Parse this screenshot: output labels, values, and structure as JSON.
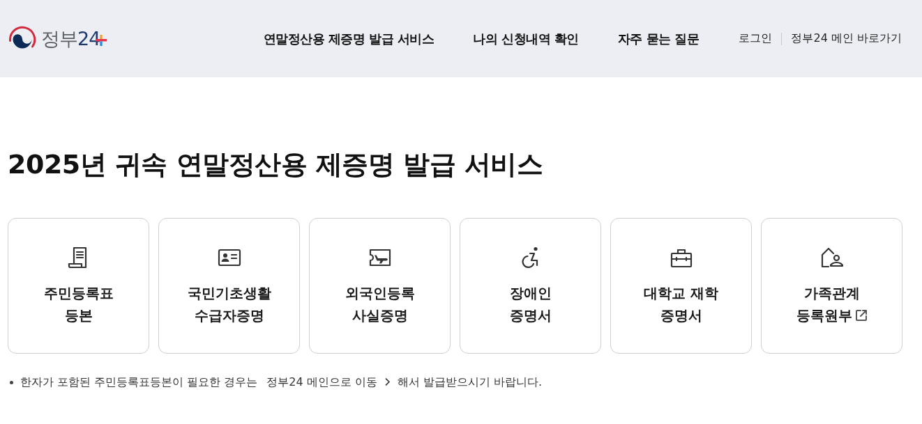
{
  "header": {
    "logo": {
      "name": "정부",
      "number": "24"
    },
    "nav": [
      {
        "label": "연말정산용 제증명 발급 서비스"
      },
      {
        "label": "나의 신청내역 확인"
      },
      {
        "label": "자주 묻는 질문"
      }
    ],
    "utility_links": [
      {
        "label": "로그인"
      },
      {
        "label": "정부24 메인 바로가기"
      }
    ]
  },
  "page_title": "2025년 귀속 연말정산용 제증명 발급 서비스",
  "cards": [
    {
      "lines": [
        "주민등록표",
        "등본"
      ],
      "external": false
    },
    {
      "lines": [
        "국민기초생활",
        "수급자증명"
      ],
      "external": false
    },
    {
      "lines": [
        "외국인등록",
        "사실증명"
      ],
      "external": false
    },
    {
      "lines": [
        "장애인",
        "증명서"
      ],
      "external": false
    },
    {
      "lines": [
        "대학교 재학",
        "증명서"
      ],
      "external": false
    },
    {
      "lines": [
        "가족관계",
        "등록원부"
      ],
      "external": true
    }
  ],
  "notice": {
    "before": "한자가 포함된 주민등록표등본이 필요한 경우는",
    "link": "정부24 메인으로 이동",
    "after": "해서 발급받으시기 바랍니다."
  }
}
